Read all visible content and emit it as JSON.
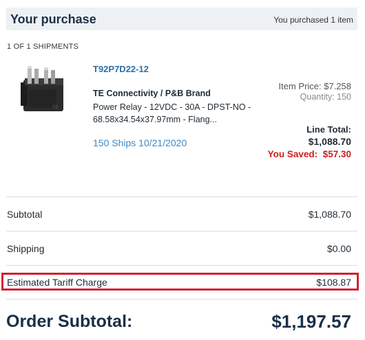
{
  "header": {
    "title": "Your purchase",
    "purchased_text": "You purchased 1 item"
  },
  "shipment": {
    "label": "1 OF 1 SHIPMENTS"
  },
  "item": {
    "part_number": "T92P7D22-12",
    "brand": "TE Connectivity / P&B Brand",
    "description": "Power Relay - 12VDC - 30A - DPST-NO - 68.58x34.54x37.97mm - Flang...",
    "ships": "150 Ships 10/21/2020",
    "item_price": "Item Price: $7.258",
    "quantity": "Quantity: 150",
    "line_total_label": "Line Total:",
    "line_total_value": "$1,088.70",
    "saved_label": "You Saved:",
    "saved_value": "$57.30",
    "image_icon": "relay-product-image"
  },
  "summary": {
    "subtotal_label": "Subtotal",
    "subtotal_value": "$1,088.70",
    "shipping_label": "Shipping",
    "shipping_value": "$0.00",
    "tariff_label": "Estimated Tariff Charge",
    "tariff_value": "$108.87",
    "order_subtotal_label": "Order Subtotal:",
    "order_subtotal_value": "$1,197.57"
  },
  "colors": {
    "brand_dark": "#1b2f48",
    "link_blue": "#2a6fa8",
    "ships_blue": "#3d8ac7",
    "saved_red": "#cf1f1f",
    "highlight_border": "#d2202f",
    "header_bg": "#eef1f4"
  }
}
